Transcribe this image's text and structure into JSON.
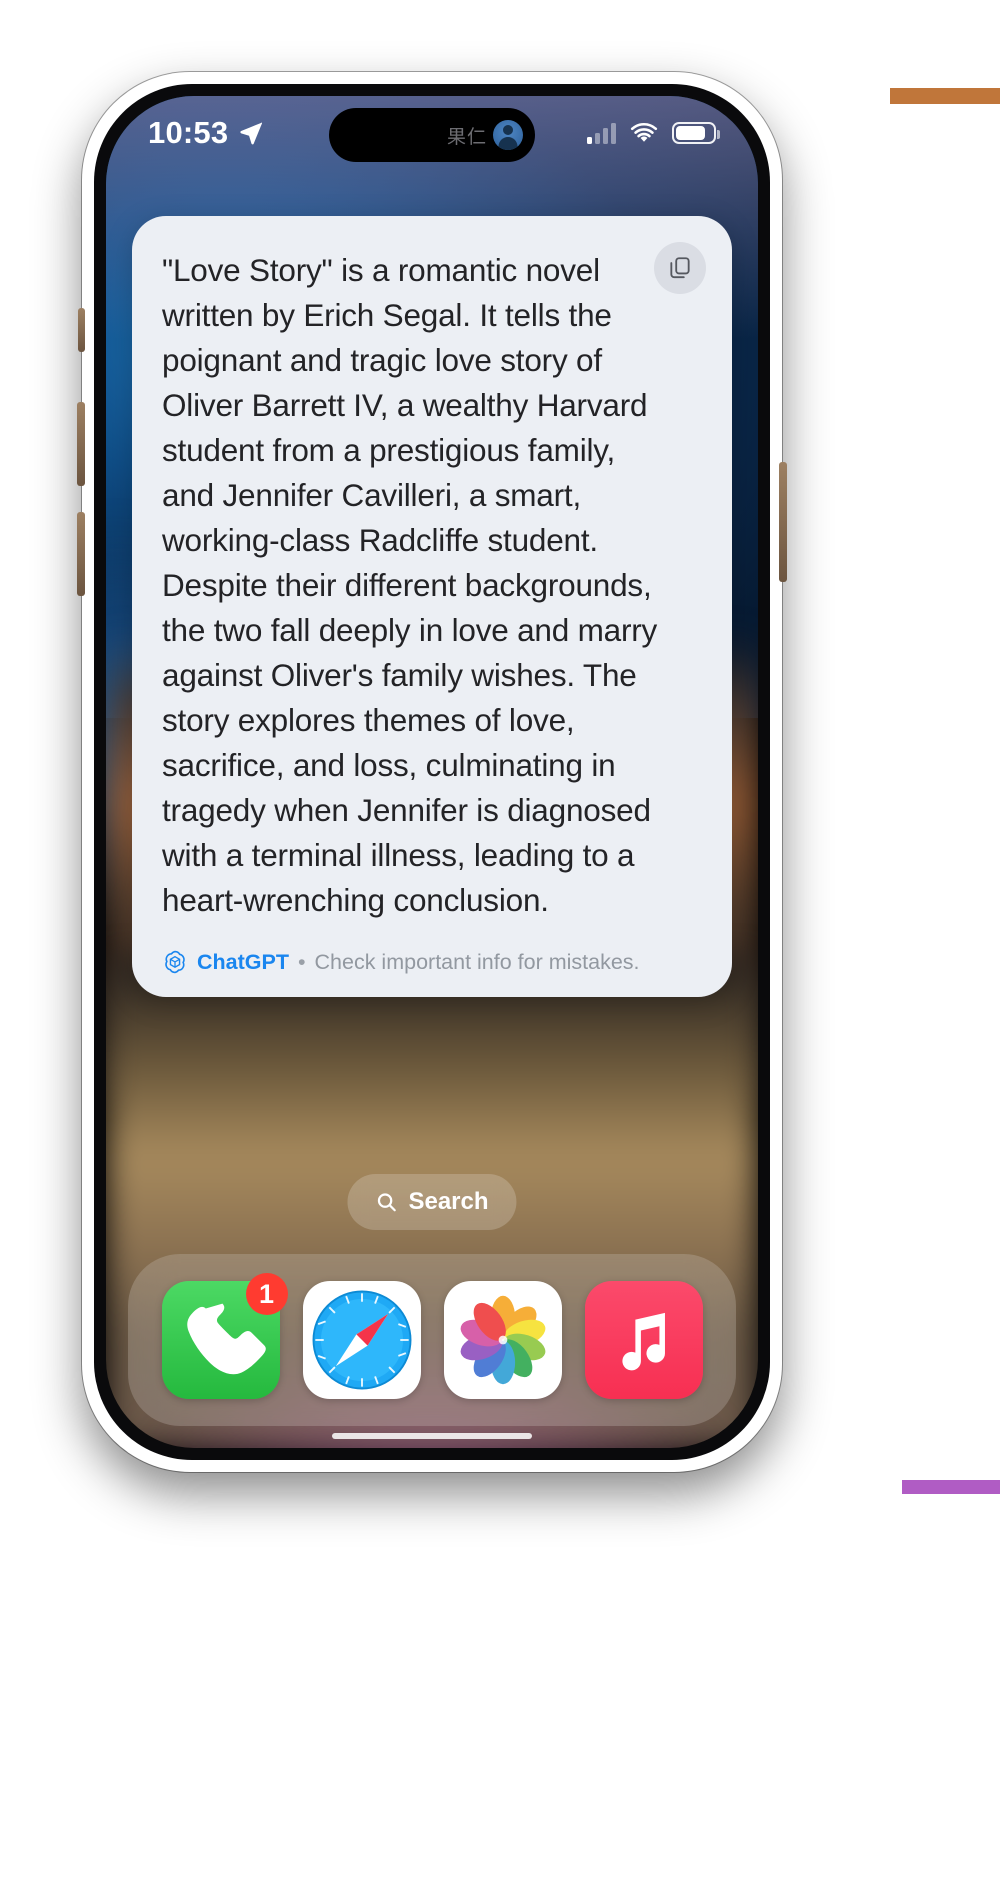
{
  "device": {
    "kind": "smartphone",
    "frame_color": "#9c7d60"
  },
  "status_bar": {
    "time": "10:53",
    "location_icon": "location-arrow-icon",
    "cellular_icon": "cellular-bars-icon",
    "cellular_bars_active": 1,
    "cellular_bars_total": 4,
    "wifi_icon": "wifi-icon",
    "battery_icon": "battery-icon",
    "battery_level_percent": 72
  },
  "dynamic_island": {
    "contact_name": "果仁",
    "avatar_icon": "contact-avatar-icon"
  },
  "answer_card": {
    "text": "\"Love Story\" is a romantic novel written by Erich Segal. It tells the poignant and tragic love story of Oliver Barrett IV, a wealthy Harvard student from a prestigious family, and Jennifer Cavilleri, a smart, working-class Radcliffe student. Despite their different backgrounds, the two fall deeply in love and marry against Oliver's family wishes. The story explores themes of love, sacrifice, and loss, culminating in tragedy when Jennifer is diagnosed with a terminal illness, leading to a heart-wrenching conclusion.",
    "copy_icon": "copy-documents-icon",
    "background_color": "#eceff4",
    "text_color": "#232326",
    "footer": {
      "logo_icon": "chatgpt-logo-icon",
      "brand": "ChatGPT",
      "separator": "•",
      "disclaimer": "Check important info for mistakes.",
      "brand_color": "#1a86ef",
      "disclaimer_color": "#9298a0"
    }
  },
  "search_pill": {
    "icon": "search-icon",
    "label": "Search"
  },
  "dock": {
    "apps": [
      {
        "name": "Phone",
        "icon": "phone-handset-icon",
        "badge": "1"
      },
      {
        "name": "Safari",
        "icon": "safari-compass-icon",
        "badge": ""
      },
      {
        "name": "Photos",
        "icon": "photos-pinwheel-icon",
        "badge": ""
      },
      {
        "name": "Music",
        "icon": "music-note-icon",
        "badge": ""
      }
    ]
  },
  "home_indicator": {
    "label": "home-indicator"
  }
}
